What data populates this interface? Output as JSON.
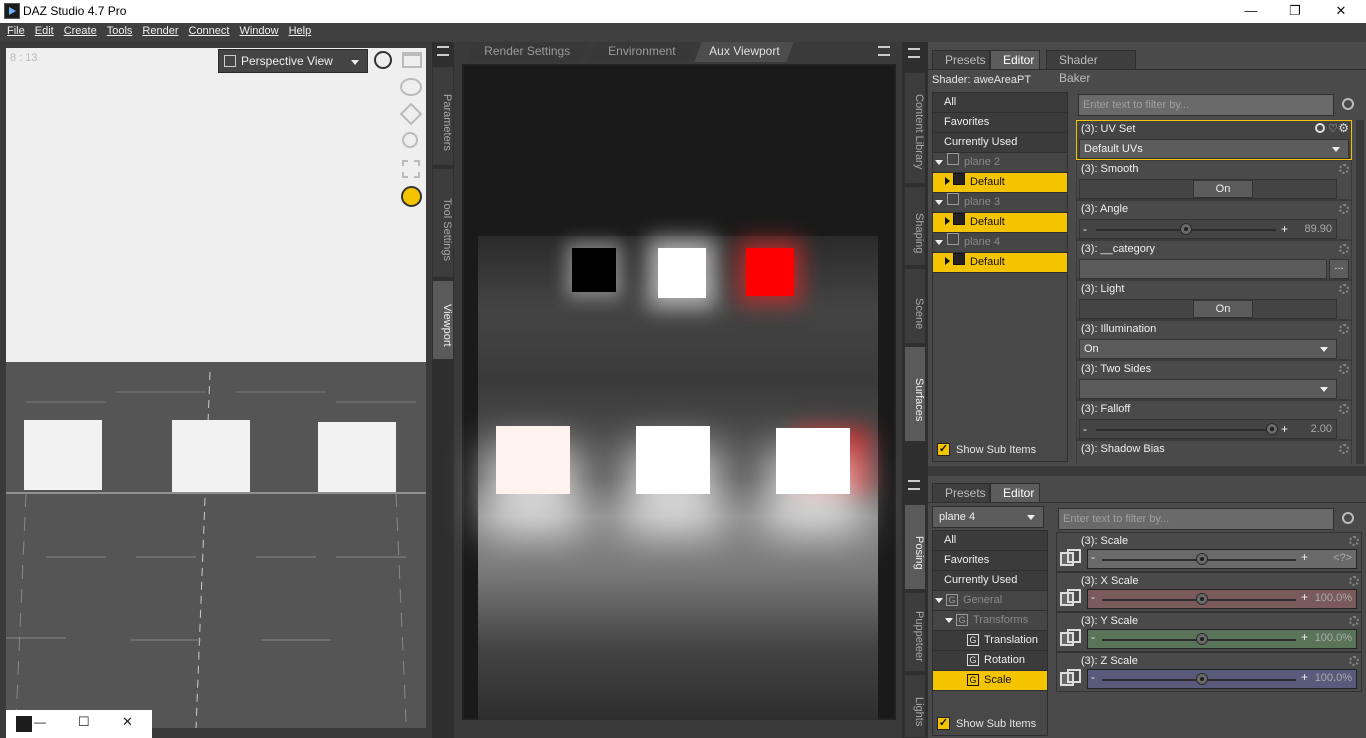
{
  "window": {
    "title": "DAZ Studio 4.7 Pro",
    "minimize": "—",
    "restore": "❐",
    "close": "✕"
  },
  "menu": [
    "File",
    "Edit",
    "Create",
    "Tools",
    "Render",
    "Connect",
    "Window",
    "Help"
  ],
  "viewport": {
    "fps": "8 : 13",
    "view_mode": "Perspective View"
  },
  "left_tabs": [
    "Parameters",
    "Tool Settings",
    "Viewport"
  ],
  "center_tabs": [
    "Render Settings",
    "Environment",
    "Aux Viewport"
  ],
  "right_tabs_top": [
    "Content Library",
    "Shaping",
    "Scene",
    "Surfaces"
  ],
  "right_tabs_bottom": [
    "Posing",
    "Puppeteer",
    "Lights"
  ],
  "surfaces": {
    "tabs": [
      "Presets",
      "Editor",
      "Shader Baker"
    ],
    "shader": "Shader: aweAreaPT",
    "filter_placeholder": "Enter text to filter by...",
    "tree": [
      {
        "label": "All",
        "kind": "row"
      },
      {
        "label": "Favorites",
        "kind": "row"
      },
      {
        "label": "Currently Used",
        "kind": "row"
      },
      {
        "label": "plane 2",
        "kind": "node"
      },
      {
        "label": "Default",
        "kind": "sel"
      },
      {
        "label": "plane 3",
        "kind": "node"
      },
      {
        "label": "Default",
        "kind": "sel"
      },
      {
        "label": "plane 4",
        "kind": "node"
      },
      {
        "label": "Default",
        "kind": "sel"
      }
    ],
    "show_sub_items": "Show Sub Items",
    "props": {
      "uvset": {
        "label": "(3): UV Set",
        "value": "Default UVs"
      },
      "smooth": {
        "label": "(3): Smooth",
        "value": "On"
      },
      "angle": {
        "label": "(3): Angle",
        "value": "89.90",
        "level": 0.5
      },
      "category": {
        "label": "(3): __category",
        "button": "..."
      },
      "light": {
        "label": "(3): Light",
        "value": "On"
      },
      "illumination": {
        "label": "(3): Illumination",
        "value": "On"
      },
      "twosides": {
        "label": "(3): Two Sides",
        "value": ""
      },
      "falloff": {
        "label": "(3): Falloff",
        "value": "2.00",
        "level": 0.98
      },
      "shadowbias": {
        "label": "(3): Shadow Bias"
      }
    }
  },
  "parameters": {
    "tabs": [
      "Presets",
      "Editor"
    ],
    "node": "plane 4",
    "filter_placeholder": "Enter text to filter by...",
    "tree": [
      "All",
      "Favorites",
      "Currently Used",
      "General",
      "Transforms",
      "Translation",
      "Rotation",
      "Scale"
    ],
    "show_sub_items": "Show Sub Items",
    "props": [
      {
        "label": "(3): Scale",
        "value": "<?>",
        "color": "#6a6a6a"
      },
      {
        "label": "(3): X Scale",
        "value": "100.0%",
        "color": "#7a5a5a"
      },
      {
        "label": "(3): Y Scale",
        "value": "100.0%",
        "color": "#5a745a"
      },
      {
        "label": "(3): Z Scale",
        "value": "100.0%",
        "color": "#5a5a7c"
      }
    ]
  },
  "taskbar": {
    "minimize": "—",
    "restore": "☐",
    "close": "✕"
  }
}
